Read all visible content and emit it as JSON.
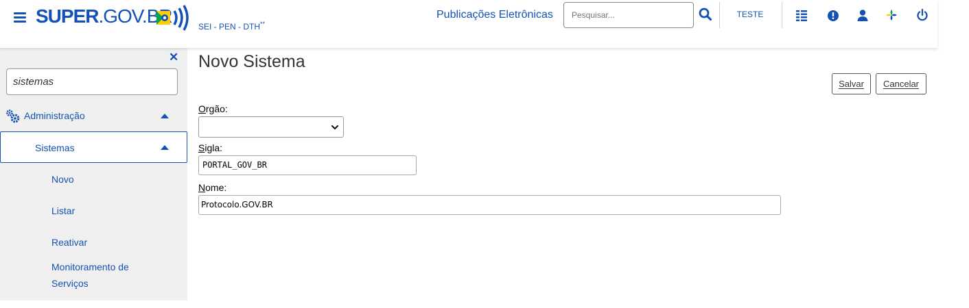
{
  "header": {
    "logo_bold": "SUPER",
    "logo_rest": ".GOV.BR",
    "subtitle": "SEI - PEN - DTH",
    "subtitle_sup": "**",
    "title": "Publicações Eletrônicas",
    "search_placeholder": "Pesquisar...",
    "user_label": "TESTE",
    "icons": [
      "menu-icon",
      "search-icon",
      "grid-list-icon",
      "exclamation-circle-icon",
      "user-icon",
      "sei-logo-icon",
      "power-icon"
    ],
    "accent": "#1351b4"
  },
  "sidebar": {
    "search_value": "sistemas",
    "items": [
      {
        "label": "Administração"
      },
      {
        "label": "Sistemas"
      }
    ],
    "subitems": [
      {
        "label": "Novo"
      },
      {
        "label": "Listar"
      },
      {
        "label": "Reativar"
      },
      {
        "label": "Monitoramento de"
      },
      {
        "label": "Serviços"
      }
    ]
  },
  "main": {
    "title": "Novo Sistema",
    "save_label_first": "S",
    "save_label_rest": "alvar",
    "cancel_label_first": "C",
    "cancel_label_rest": "ancelar",
    "orgao_first": "O",
    "orgao_rest": "rgão:",
    "orgao_value": "",
    "sigla_first": "S",
    "sigla_rest": "igla:",
    "sigla_value": "PORTAL_GOV_BR",
    "nome_first": "N",
    "nome_rest": "ome:",
    "nome_value": "Protocolo.GOV.BR"
  }
}
